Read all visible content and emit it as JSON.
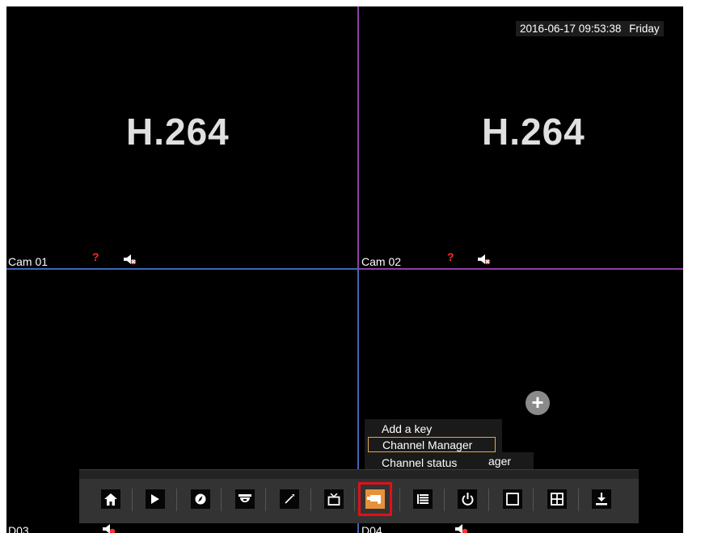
{
  "datetime": {
    "date": "2016-06-17 09:53:38",
    "weekday": "Friday"
  },
  "channels": [
    {
      "label": "Cam 01",
      "codec": "H.264",
      "status_mark": "?"
    },
    {
      "label": "Cam 02",
      "codec": "H.264",
      "status_mark": "?"
    },
    {
      "label": "D03"
    },
    {
      "label": "D04"
    }
  ],
  "context_menu": {
    "items": [
      "Add a key",
      "Channel Manager",
      "Channel status"
    ],
    "selected": "Channel Manager",
    "truncated_tooltip": "ager"
  },
  "plus_button": {
    "label": "+"
  },
  "toolbar": {
    "buttons": [
      {
        "icon": "home-icon",
        "glyph": "⌂"
      },
      {
        "icon": "playback-icon",
        "glyph": "▶"
      },
      {
        "icon": "compass-icon",
        "glyph": "◔"
      },
      {
        "icon": "ptz-camera-icon",
        "glyph": "⊖"
      },
      {
        "icon": "magic-wand-icon",
        "glyph": "↗"
      },
      {
        "icon": "tv-icon",
        "glyph": "⌂"
      },
      {
        "icon": "channel-camera-icon",
        "glyph": "▭",
        "active": true
      },
      {
        "icon": "list-icon",
        "glyph": "≣"
      },
      {
        "icon": "power-icon",
        "glyph": "⏻"
      },
      {
        "icon": "single-view-icon",
        "glyph": "□"
      },
      {
        "icon": "quad-view-icon",
        "glyph": "⊞"
      },
      {
        "icon": "download-icon",
        "glyph": "⤓"
      }
    ],
    "highlight_color": "#e0101a",
    "active_color": "#e8913a"
  },
  "colors": {
    "top_grid": "#8e3fa8",
    "bottom_grid": "#3f68b8",
    "status_mark": "#ff2a2a"
  }
}
